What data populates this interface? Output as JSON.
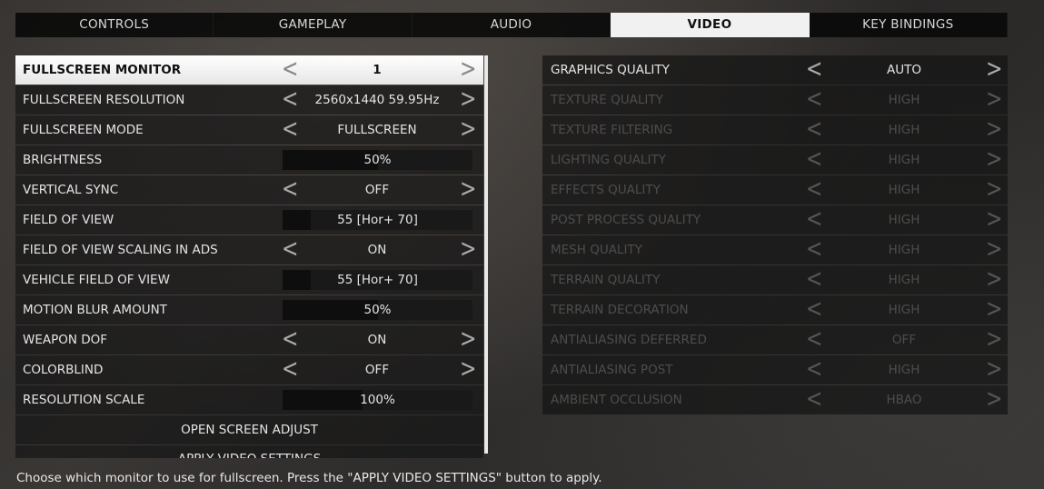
{
  "tabs": [
    {
      "label": "CONTROLS"
    },
    {
      "label": "GAMEPLAY"
    },
    {
      "label": "AUDIO"
    },
    {
      "label": "VIDEO"
    },
    {
      "label": "KEY BINDINGS"
    }
  ],
  "left": {
    "rows": [
      {
        "label": "FULLSCREEN MONITOR",
        "value": "1"
      },
      {
        "label": "FULLSCREEN RESOLUTION",
        "value": "2560x1440 59.95Hz"
      },
      {
        "label": "FULLSCREEN MODE",
        "value": "FULLSCREEN"
      },
      {
        "label": "BRIGHTNESS",
        "value": "50%",
        "level": 0.5
      },
      {
        "label": "VERTICAL SYNC",
        "value": "OFF"
      },
      {
        "label": "FIELD OF VIEW",
        "value": "55  [Hor+ 70]",
        "level": 0.15
      },
      {
        "label": "FIELD OF VIEW SCALING IN ADS",
        "value": "ON"
      },
      {
        "label": "VEHICLE FIELD OF VIEW",
        "value": "55  [Hor+ 70]",
        "level": 0.15
      },
      {
        "label": "MOTION BLUR AMOUNT",
        "value": "50%",
        "level": 0.5
      },
      {
        "label": "WEAPON DOF",
        "value": "ON"
      },
      {
        "label": "COLORBLIND",
        "value": "OFF"
      },
      {
        "label": "RESOLUTION SCALE",
        "value": "100%",
        "level": 0.42
      }
    ],
    "open_screen_adjust": "OPEN SCREEN ADJUST",
    "apply_video_settings": "APPLY VIDEO SETTINGS"
  },
  "right": {
    "rows": [
      {
        "label": "GRAPHICS QUALITY",
        "value": "AUTO"
      },
      {
        "label": "TEXTURE QUALITY",
        "value": "HIGH"
      },
      {
        "label": "TEXTURE FILTERING",
        "value": "HIGH"
      },
      {
        "label": "LIGHTING QUALITY",
        "value": "HIGH"
      },
      {
        "label": "EFFECTS QUALITY",
        "value": "HIGH"
      },
      {
        "label": "POST PROCESS QUALITY",
        "value": "HIGH"
      },
      {
        "label": "MESH QUALITY",
        "value": "HIGH"
      },
      {
        "label": "TERRAIN QUALITY",
        "value": "HIGH"
      },
      {
        "label": "TERRAIN DECORATION",
        "value": "HIGH"
      },
      {
        "label": "ANTIALIASING DEFERRED",
        "value": "OFF"
      },
      {
        "label": "ANTIALIASING POST",
        "value": "HIGH"
      },
      {
        "label": "AMBIENT OCCLUSION",
        "value": "HBAO"
      }
    ]
  },
  "help_text": "Choose which monitor to use for fullscreen. Press the \"APPLY VIDEO SETTINGS\" button to apply.",
  "arrows": {
    "left": "<",
    "right": ">"
  }
}
